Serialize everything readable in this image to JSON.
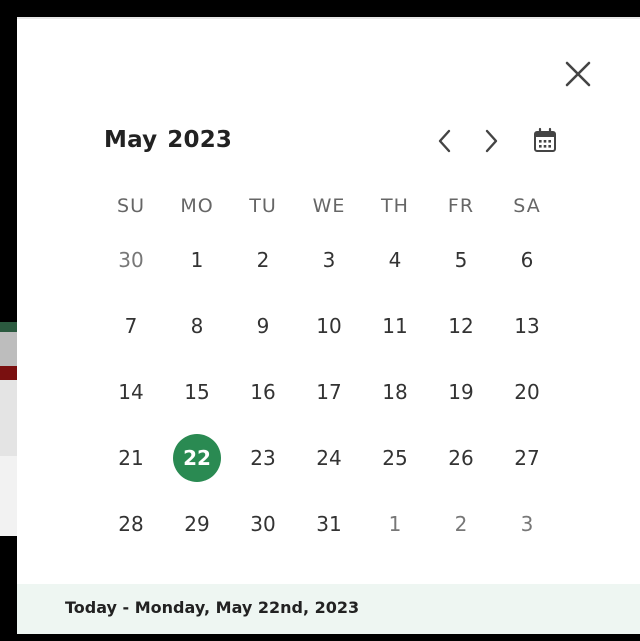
{
  "dialog": {
    "close_icon": "close-icon"
  },
  "header": {
    "month": "May",
    "year": "2023",
    "prev_icon": "chevron-left-icon",
    "next_icon": "chevron-right-icon",
    "calendar_icon": "calendar-icon"
  },
  "weekdays": [
    "SU",
    "MO",
    "TU",
    "WE",
    "TH",
    "FR",
    "SA"
  ],
  "weeks": [
    [
      {
        "day": "30",
        "muted": true
      },
      {
        "day": "1"
      },
      {
        "day": "2"
      },
      {
        "day": "3"
      },
      {
        "day": "4"
      },
      {
        "day": "5"
      },
      {
        "day": "6"
      }
    ],
    [
      {
        "day": "7"
      },
      {
        "day": "8"
      },
      {
        "day": "9"
      },
      {
        "day": "10"
      },
      {
        "day": "11"
      },
      {
        "day": "12"
      },
      {
        "day": "13"
      }
    ],
    [
      {
        "day": "14"
      },
      {
        "day": "15"
      },
      {
        "day": "16"
      },
      {
        "day": "17"
      },
      {
        "day": "18"
      },
      {
        "day": "19"
      },
      {
        "day": "20"
      }
    ],
    [
      {
        "day": "21"
      },
      {
        "day": "22",
        "selected": true
      },
      {
        "day": "23"
      },
      {
        "day": "24"
      },
      {
        "day": "25"
      },
      {
        "day": "26"
      },
      {
        "day": "27"
      }
    ],
    [
      {
        "day": "28"
      },
      {
        "day": "29"
      },
      {
        "day": "30"
      },
      {
        "day": "31"
      },
      {
        "day": "1",
        "muted": true
      },
      {
        "day": "2",
        "muted": true
      },
      {
        "day": "3",
        "muted": true
      }
    ]
  ],
  "footer": {
    "today_label": "Today - Monday, May 22nd, 2023"
  },
  "colors": {
    "selected": "#2a8a52",
    "footer_bg": "#eef6f2",
    "text": "#333333",
    "muted_text": "#777777"
  }
}
